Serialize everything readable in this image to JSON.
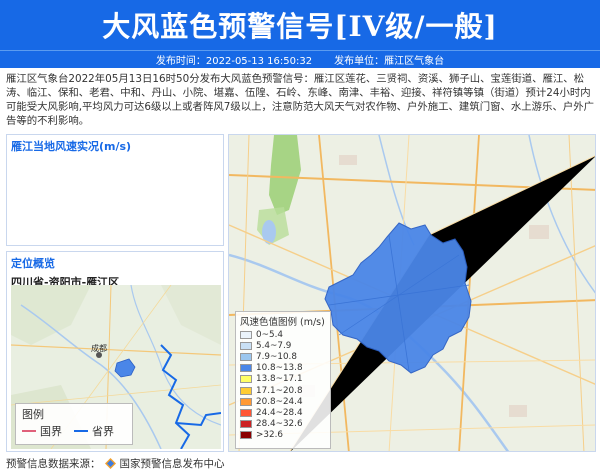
{
  "banner": {
    "title": "大风蓝色预警信号[IV级/一般]"
  },
  "meta": {
    "time_label": "发布时间：2022-05-13 16:50:32",
    "issuer_label": "发布单位：雁江区气象台"
  },
  "content": "雁江区气象台2022年05月13日16时50分发布大风蓝色预警信号：雁江区莲花、三贤祠、资溪、狮子山、宝莲街道、雁江、松涛、临江、保和、老君、中和、丹山、小院、堪嘉、伍隍、石岭、东峰、南津、丰裕、迎接、祥符镇等镇（街道）预计24小时内可能受大风影响,平均风力可达6级以上或者阵风7级以上，注意防范大风天气对农作物、户外施工、建筑门窗、水上游乐、户外广告等的不利影响。",
  "wind_panel": {
    "title": "雁江当地风速实况(m/s)"
  },
  "location_panel": {
    "title": "定位概览",
    "place": "四川省-资阳市-雁江区",
    "mini_map_city": "成都",
    "legend": {
      "title": "图例",
      "items": [
        {
          "label": "国界",
          "color": "#e0607a"
        },
        {
          "label": "省界",
          "color": "#1769e6"
        }
      ]
    }
  },
  "wind_legend": {
    "title": "风速色值图例 (m/s)",
    "items": [
      {
        "label": "0~5.4",
        "color": "#eaf3fb"
      },
      {
        "label": "5.4~7.9",
        "color": "#c9e0f5"
      },
      {
        "label": "7.9~10.8",
        "color": "#9cc7ef"
      },
      {
        "label": "10.8~13.8",
        "color": "#4a86e8"
      },
      {
        "label": "13.8~17.1",
        "color": "#ffff66"
      },
      {
        "label": "17.1~20.8",
        "color": "#ffcc33"
      },
      {
        "label": "20.8~24.4",
        "color": "#ff9933"
      },
      {
        "label": "24.4~28.4",
        "color": "#ff5533"
      },
      {
        "label": "28.4~32.6",
        "color": "#cc2222"
      },
      {
        "label": ">32.6",
        "color": "#8b0000"
      }
    ]
  },
  "footer": {
    "source_label": "预警信息数据来源：",
    "source_name": "国家预警信息发布中心"
  }
}
